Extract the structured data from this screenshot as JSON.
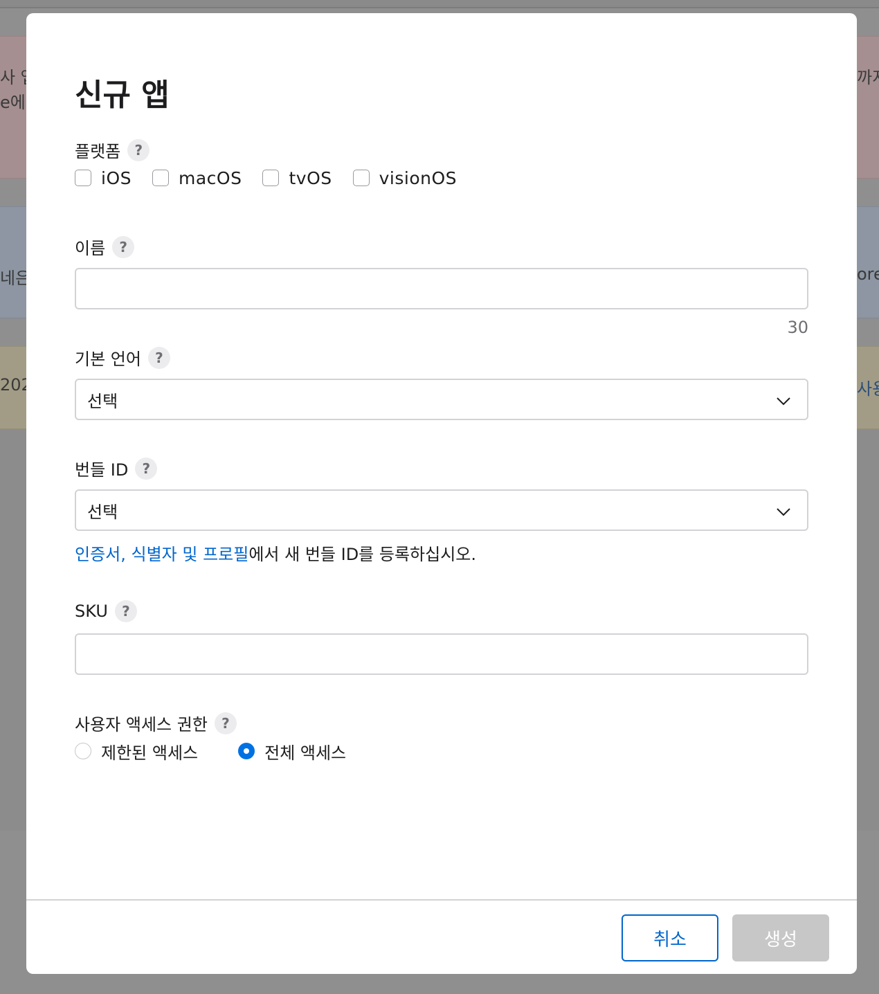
{
  "background": {
    "red_left_line1": "사 앱",
    "red_left_line2": "e에",
    "red_right": "까지",
    "blue_left": "네은 v",
    "blue_right": "ore",
    "yellow_left": "202",
    "yellow_right": "사용"
  },
  "modal": {
    "title": "신규 앱",
    "platform": {
      "label": "플랫폼",
      "help": "?",
      "options": [
        "iOS",
        "macOS",
        "tvOS",
        "visionOS"
      ]
    },
    "name": {
      "label": "이름",
      "help": "?",
      "value": "",
      "counter": "30"
    },
    "primary_language": {
      "label": "기본 언어",
      "help": "?",
      "selected": "선택"
    },
    "bundle_id": {
      "label": "번들 ID",
      "help": "?",
      "selected": "선택",
      "helper_link": "인증서, 식별자 및 프로필",
      "helper_text": "에서 새 번들 ID를 등록하십시오."
    },
    "sku": {
      "label": "SKU",
      "help": "?",
      "value": ""
    },
    "user_access": {
      "label": "사용자 액세스 권한",
      "help": "?",
      "options": [
        "제한된 액세스",
        "전체 액세스"
      ],
      "selected_index": 1
    },
    "buttons": {
      "cancel": "취소",
      "create": "생성"
    }
  },
  "colors": {
    "accent": "#0071e3",
    "link": "#0066cc",
    "disabled_button": "#c7c7c7"
  }
}
